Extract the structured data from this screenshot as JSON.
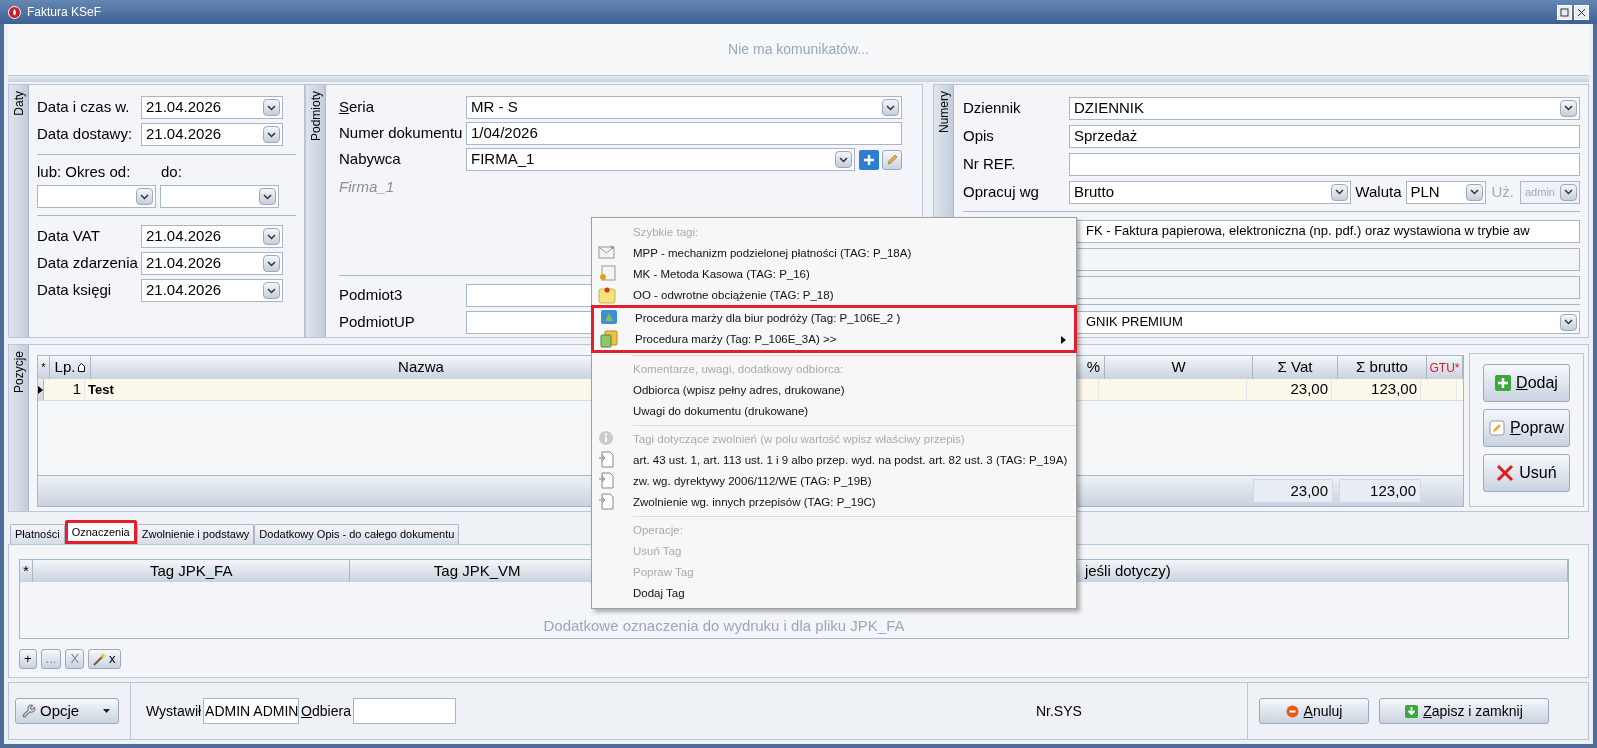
{
  "window": {
    "title": "Faktura KSeF"
  },
  "message": "Nie ma komunikatów...",
  "daty": {
    "caption": "Daty",
    "top_rows": [
      {
        "label": "Data i czas w.",
        "value": "21.04.2026"
      },
      {
        "label": "Data dostawy:",
        "value": "21.04.2026"
      }
    ],
    "period": {
      "from_label": "lub: Okres od:",
      "to_label": "do:"
    },
    "bottom_rows": [
      {
        "label": "Data VAT",
        "value": "21.04.2026"
      },
      {
        "label": "Data zdarzenia",
        "value": "21.04.2026"
      },
      {
        "label": "Data księgi",
        "value": "21.04.2026"
      }
    ]
  },
  "podmioty": {
    "caption": "Podmioty",
    "seria": {
      "label": "Seria",
      "accelerator": true,
      "value": "MR - S"
    },
    "numer": {
      "label": "Numer dokumentu",
      "value": "1/04/2026"
    },
    "nabywca": {
      "label": "Nabywca",
      "value": "FIRMA_1",
      "name": "Firma_1"
    },
    "extra_rows": [
      {
        "label": "Podmiot3"
      },
      {
        "label": "PodmiotUP"
      }
    ]
  },
  "numery": {
    "caption": "Numery",
    "rows": [
      {
        "kind": "combo",
        "label": "Dziennik",
        "value": "DZIENNIK"
      },
      {
        "kind": "text",
        "label": "Opis",
        "value": "Sprzedaż"
      },
      {
        "kind": "text",
        "label": "Nr REF."
      }
    ],
    "opracuj": {
      "label": "Opracuj wg",
      "value": "Brutto",
      "currency_label": "Waluta",
      "currency": "PLN",
      "user_label": "Uż.",
      "user": "admin",
      "user_disabled": true
    },
    "lower_rows": [
      {
        "kind": "text",
        "value": "FK - Faktura papierowa, elektroniczna (np. pdf.) oraz wystawiona w trybie aw"
      },
      {
        "kind": "readonly"
      },
      {
        "kind": "readonly"
      },
      {
        "kind": "combo",
        "value": "GNIK PREMIUM"
      }
    ]
  },
  "pozycje": {
    "caption": "Pozycje",
    "columns": [
      {
        "label": "*",
        "sorted": false,
        "required": false
      },
      {
        "label": "Lp.",
        "sorted": true,
        "required": false
      },
      {
        "label": "Nazwa",
        "sorted": false,
        "required": false
      },
      {
        "label": "%",
        "sorted": false,
        "required": false
      },
      {
        "label": "W",
        "sorted": false,
        "required": false
      },
      {
        "label": "Σ Vat",
        "sorted": false,
        "required": false
      },
      {
        "label": "Σ brutto",
        "sorted": false,
        "required": false
      },
      {
        "label": "GTU*",
        "sorted": false,
        "required": true
      }
    ],
    "rows": [
      {
        "current": true,
        "lp": "1",
        "name": "Test",
        "vat": "23,00",
        "brutto": "123,00"
      }
    ],
    "totals": {
      "vat": "23,00",
      "brutto": "123,00"
    },
    "buttons": [
      {
        "label": "Dodaj",
        "accelerator": true
      },
      {
        "label": "Popraw",
        "accelerator": true
      },
      {
        "label": "Usuń",
        "accelerator": false
      }
    ]
  },
  "tabs": [
    {
      "label": "Płatności",
      "selected": false,
      "highlighted": false
    },
    {
      "label": "Oznaczenia",
      "selected": true,
      "highlighted": true
    },
    {
      "label": "Zwolnienie i podstawy",
      "selected": false,
      "highlighted": false
    },
    {
      "label": "Dodatkowy Opis - do całego dokumentu",
      "selected": false,
      "highlighted": false
    }
  ],
  "tags_grid": {
    "columns": [
      "*",
      "Tag JPK_FA",
      "Tag JPK_VM",
      "jeśli dotyczy)"
    ],
    "empty_text": "Dodatkowe oznaczenia do wydruku i dla pliku JPK_FA",
    "toolbar": [
      {
        "kind": "text",
        "label": "+",
        "disabled": false
      },
      {
        "kind": "text",
        "label": "...",
        "disabled": true
      },
      {
        "kind": "text",
        "label": "X",
        "disabled": true
      },
      {
        "kind": "wand",
        "label": "x",
        "disabled": false
      }
    ]
  },
  "footer": {
    "options_button": "Opcje",
    "issued_label": "Wystawił",
    "issued_value": "ADMIN ADMIN",
    "receiver_label": "Odbiera",
    "nr_sys": "Nr.SYS",
    "buttons": [
      {
        "kind": "cancel",
        "label": "Anuluj"
      },
      {
        "kind": "save",
        "label": "Zapisz i zamknij"
      }
    ]
  },
  "context_menu": {
    "items": [
      {
        "kind": "header",
        "label": "Szybkie tagi:"
      },
      {
        "kind": "item",
        "label": "MPP - mechanizm podzielonej płatności (TAG: P_18A)",
        "disabled": false,
        "highlighted": false
      },
      {
        "kind": "item",
        "label": "MK - Metoda Kasowa (TAG: P_16)",
        "disabled": false,
        "highlighted": false
      },
      {
        "kind": "item",
        "label": "OO - odwrotne obciążenie (TAG: P_18)",
        "disabled": false,
        "highlighted": false
      },
      {
        "kind": "item",
        "label": "Procedura marży dla biur podróży (Tag: P_106E_2 )",
        "disabled": false,
        "highlighted": true
      },
      {
        "kind": "item",
        "label": "Procedura marży (Tag: P_106E_3A) >>",
        "disabled": false,
        "highlighted": true,
        "submenu": true
      },
      {
        "kind": "separator"
      },
      {
        "kind": "header",
        "label": "Komentarze, uwagi, dodatkowy odbiorca:"
      },
      {
        "kind": "item",
        "label": "Odbiorca (wpisz pełny adres, drukowane)",
        "disabled": false,
        "highlighted": false
      },
      {
        "kind": "item",
        "label": "Uwagi do dokumentu (drukowane)",
        "disabled": false,
        "highlighted": false
      },
      {
        "kind": "separator"
      },
      {
        "kind": "header",
        "label": "Tagi dotyczące zwolnień (w polu wartość wpisz właściwy przepis)"
      },
      {
        "kind": "item",
        "label": "art. 43 ust. 1, art. 113 ust. 1 i 9 albo przep. wyd. na podst. art. 82 ust. 3 (TAG: P_19A)",
        "disabled": false,
        "highlighted": false
      },
      {
        "kind": "item",
        "label": "zw. wg. dyrektywy 2006/112/WE (TAG: P_19B)",
        "disabled": false,
        "highlighted": false
      },
      {
        "kind": "item",
        "label": "Zwolnienie wg. innych przepisów (TAG: P_19C)",
        "disabled": false,
        "highlighted": false
      },
      {
        "kind": "separator"
      },
      {
        "kind": "header",
        "label": "Operacje:"
      },
      {
        "kind": "item",
        "label": "Usuń Tag",
        "disabled": true,
        "highlighted": false
      },
      {
        "kind": "item",
        "label": "Popraw Tag",
        "disabled": true,
        "highlighted": false
      },
      {
        "kind": "item",
        "label": "Dodaj Tag",
        "disabled": false,
        "highlighted": false
      }
    ]
  }
}
